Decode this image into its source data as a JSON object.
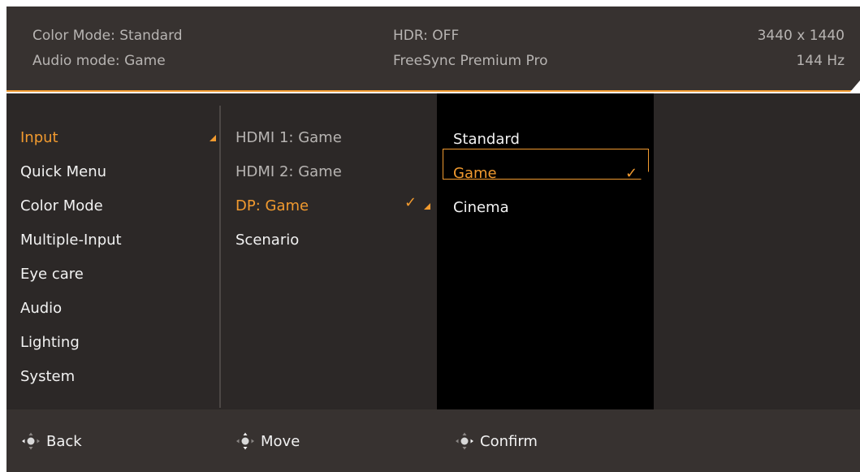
{
  "header": {
    "color_mode": "Color Mode: Standard",
    "audio_mode": "Audio mode: Game",
    "hdr": "HDR: OFF",
    "freesync": "FreeSync Premium Pro",
    "resolution": "3440 x 1440",
    "refresh": "144 Hz"
  },
  "menu": {
    "main_items": [
      {
        "label": "Input",
        "active": true
      },
      {
        "label": "Quick Menu"
      },
      {
        "label": "Color Mode"
      },
      {
        "label": "Multiple-Input"
      },
      {
        "label": "Eye care"
      },
      {
        "label": "Audio"
      },
      {
        "label": "Lighting"
      },
      {
        "label": "System"
      }
    ],
    "sub_items": [
      {
        "label": "HDMI 1: Game"
      },
      {
        "label": "HDMI 2: Game"
      },
      {
        "label": "DP: Game",
        "active": true,
        "checked": true
      },
      {
        "label": "Scenario"
      }
    ],
    "options": [
      {
        "label": "Standard"
      },
      {
        "label": "Game",
        "selected": true,
        "checked": true
      },
      {
        "label": "Cinema"
      }
    ],
    "check_glyph": "✓"
  },
  "footer": {
    "back": "Back",
    "move": "Move",
    "confirm": "Confirm",
    "icon": "joystick-icon"
  },
  "colors": {
    "accent": "#f19a2f",
    "header_bg": "#373230",
    "panel_bg": "#2c2827",
    "option_bg": "#000000"
  }
}
